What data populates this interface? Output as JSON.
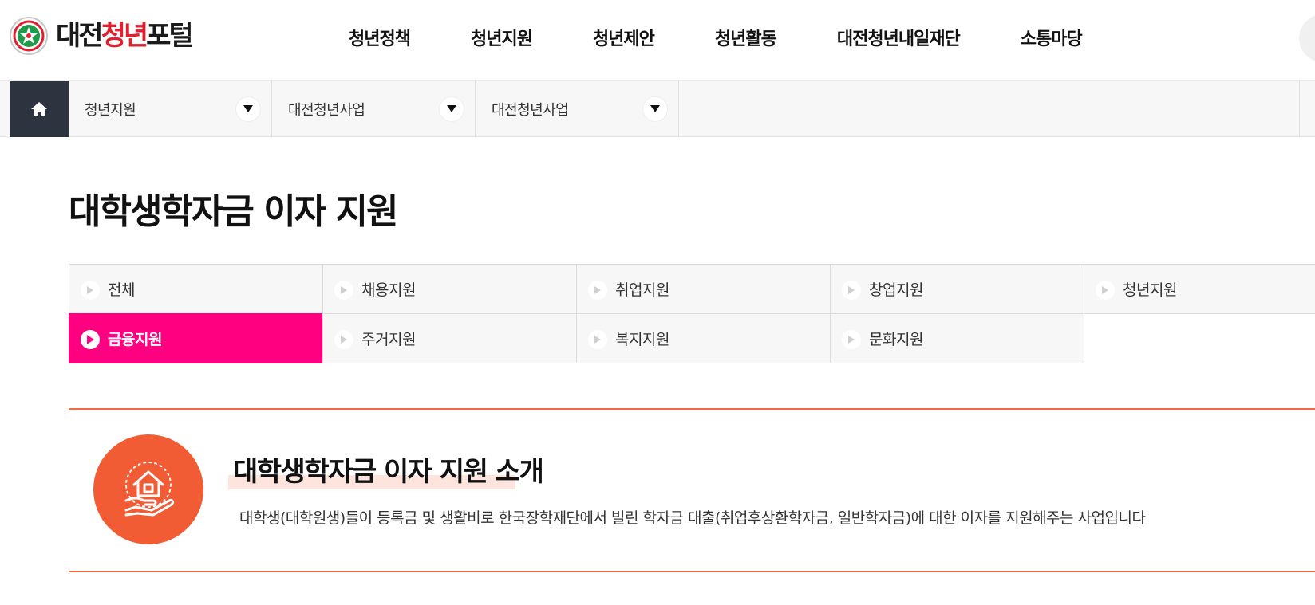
{
  "header": {
    "logo_text_prefix": "대전",
    "logo_text_highlight": "청년",
    "logo_text_suffix": "포털",
    "nav": [
      "청년정책",
      "청년지원",
      "청년제안",
      "청년활동",
      "대전청년내일재단",
      "소통마당"
    ]
  },
  "location": {
    "home_icon": "home-icon",
    "items": [
      {
        "label": "청년지원"
      },
      {
        "label": "대전청년사업"
      },
      {
        "label": "대전청년사업"
      }
    ]
  },
  "page_title": "대학생학자금 이자 지원",
  "tabs": {
    "row1": [
      "전체",
      "채용지원",
      "취업지원",
      "창업지원",
      "청년지원"
    ],
    "row2": [
      "금융지원",
      "주거지원",
      "복지지원",
      "문화지원"
    ],
    "active": "금융지원",
    "active_color": "#ff0080"
  },
  "intro": {
    "icon": "house-in-hand-icon",
    "heading_highlight": "대학생학자금 이자 지원",
    "heading_rest": " 소개",
    "description": "대학생(대학원생)들이 등록금 및 생활비로 한국장학재단에서 빌린 학자금 대출(취업후상환학자금, 일반학자금)에 대한 이자를 지원해주는 사업입니다",
    "accent_color": "#f25c35"
  }
}
